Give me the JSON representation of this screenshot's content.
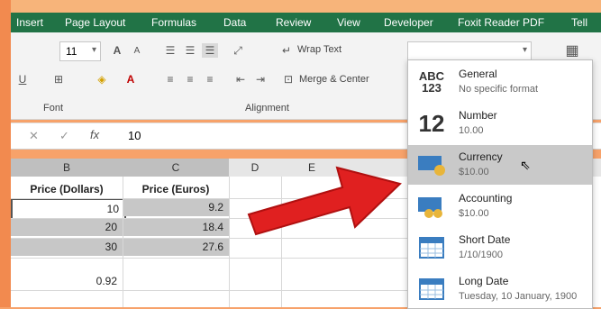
{
  "ribbon_tabs": [
    "Insert",
    "Page Layout",
    "Formulas",
    "Data",
    "Review",
    "View",
    "Developer",
    "Foxit Reader PDF",
    "Tell"
  ],
  "ribbon": {
    "font_size": "11",
    "wrap_text": "Wrap Text",
    "merge_center": "Merge & Center",
    "group_font": "Font",
    "group_alignment": "Alignment"
  },
  "formula_bar": {
    "value": "10"
  },
  "columns": [
    "B",
    "C",
    "D",
    "E"
  ],
  "table": {
    "headers": [
      "Price (Dollars)",
      "Price (Euros)"
    ],
    "rows": [
      [
        "10",
        "9.2"
      ],
      [
        "20",
        "18.4"
      ],
      [
        "30",
        "27.6"
      ]
    ],
    "extra_value": "0.92"
  },
  "number_formats": [
    {
      "name": "General",
      "sub": "No specific format",
      "icon": "ABC 123"
    },
    {
      "name": "Number",
      "sub": "10.00",
      "icon": "12"
    },
    {
      "name": "Currency",
      "sub": "$10.00",
      "icon": "currency-icon"
    },
    {
      "name": "Accounting",
      "sub": "$10.00",
      "icon": "accounting-icon"
    },
    {
      "name": "Short Date",
      "sub": "1/10/1900",
      "icon": "calendar-icon"
    },
    {
      "name": "Long Date",
      "sub": "Tuesday, 10 January, 1900",
      "icon": "calendar-icon"
    }
  ],
  "colors": {
    "excel_green": "#217346",
    "arrow_red": "#e02020",
    "selection_gray": "#c7c7c7"
  }
}
